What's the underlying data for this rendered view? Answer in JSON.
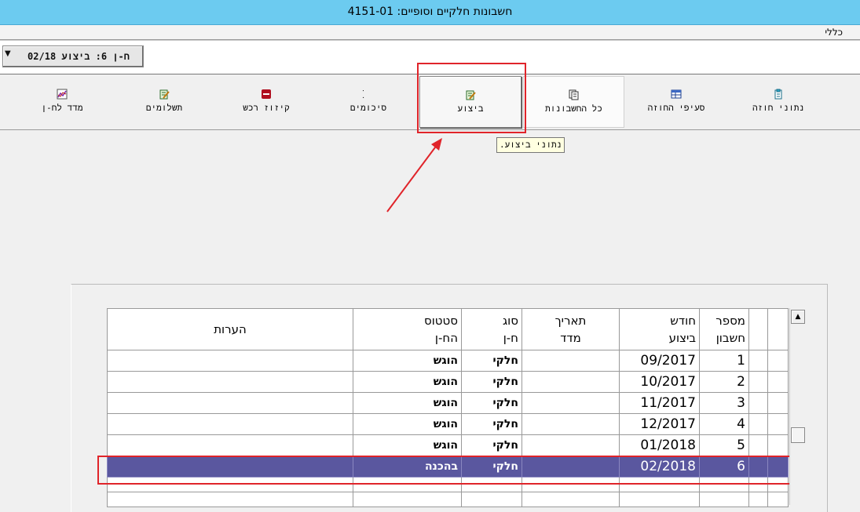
{
  "window": {
    "title": "חשבונות חלקיים וסופיים: 4151-01"
  },
  "menu": {
    "general": "כללי"
  },
  "selector": {
    "value": "ח-ן 6: ביצוע 02/18"
  },
  "toolbar": {
    "buttons": [
      {
        "id": "contract-data",
        "label": "נתוני חוזה",
        "icon": "clipboard-icon"
      },
      {
        "id": "contract-items",
        "label": "סעיפי החוזה",
        "icon": "table-icon"
      },
      {
        "id": "all-accounts",
        "label": "כל החשבונות",
        "icon": "documents-stack-icon"
      },
      {
        "id": "execution",
        "label": "ביצוע",
        "icon": "edit-document-icon"
      },
      {
        "id": "summaries",
        "label": "סיכומים",
        "icon": "sigma-icon"
      },
      {
        "id": "property-deduction",
        "label": "קיזוז רכש",
        "icon": "stop-icon"
      },
      {
        "id": "payments",
        "label": "תשלומים",
        "icon": "edit-document-icon"
      },
      {
        "id": "index-account",
        "label": "מדד לח-ן",
        "icon": "chart-icon"
      }
    ]
  },
  "tooltip": {
    "text": "נתוני ביצוע."
  },
  "grid": {
    "headers": {
      "account_no": [
        "מספר",
        "חשבון"
      ],
      "exec_month": [
        "חודש",
        "ביצוע"
      ],
      "index_date": [
        "תאריך",
        "מדד"
      ],
      "type": [
        "סוג",
        "ח-ן"
      ],
      "status": [
        "סטטוס",
        "הח-ן"
      ],
      "notes": "הערות"
    },
    "rows": [
      {
        "account_no": "1",
        "exec_month": "09/2017",
        "index_date": "",
        "type": "חלקי",
        "status": "הוגש",
        "notes": ""
      },
      {
        "account_no": "2",
        "exec_month": "10/2017",
        "index_date": "",
        "type": "חלקי",
        "status": "הוגש",
        "notes": ""
      },
      {
        "account_no": "3",
        "exec_month": "11/2017",
        "index_date": "",
        "type": "חלקי",
        "status": "הוגש",
        "notes": ""
      },
      {
        "account_no": "4",
        "exec_month": "12/2017",
        "index_date": "",
        "type": "חלקי",
        "status": "הוגש",
        "notes": ""
      },
      {
        "account_no": "5",
        "exec_month": "01/2018",
        "index_date": "",
        "type": "חלקי",
        "status": "הוגש",
        "notes": ""
      },
      {
        "account_no": "6",
        "exec_month": "02/2018",
        "index_date": "",
        "type": "חלקי",
        "status": "בהכנה",
        "notes": "",
        "selected": true
      }
    ]
  },
  "colors": {
    "selected_row": "#5a579f",
    "highlight": "#e0242a",
    "titlebar": "#6ccbf0"
  }
}
